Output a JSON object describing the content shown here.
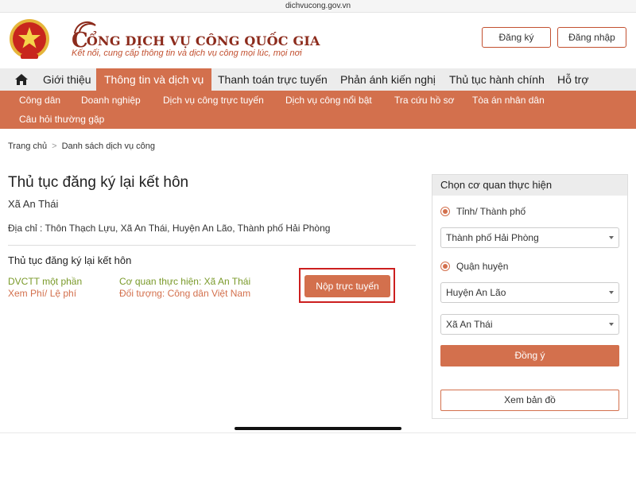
{
  "browser": {
    "url": "dichvucong.gov.vn"
  },
  "header": {
    "title": "ỔNG DỊCH VỤ CÔNG QUỐC GIA",
    "title_initial": "C",
    "subtitle": "Kết nối, cung cấp thông tin và dịch vụ công mọi lúc, mọi nơi",
    "register_label": "Đăng ký",
    "login_label": "Đăng nhập"
  },
  "main_nav": {
    "items": [
      {
        "label": "Giới thiệu",
        "active": false
      },
      {
        "label": "Thông tin và dịch vụ",
        "active": true
      },
      {
        "label": "Thanh toán trực tuyến",
        "active": false
      },
      {
        "label": "Phản ánh kiến nghị",
        "active": false
      },
      {
        "label": "Thủ tục hành chính",
        "active": false
      },
      {
        "label": "Hỗ trợ",
        "active": false
      }
    ]
  },
  "sub_nav": {
    "items": [
      "Công dân",
      "Doanh nghiệp",
      "Dịch vụ công trực tuyến",
      "Dịch vụ công nổi bật",
      "Tra cứu hồ sơ",
      "Tòa án nhân dân",
      "Câu hỏi thường gặp"
    ]
  },
  "breadcrumb": {
    "home": "Trang chủ",
    "separator": ">",
    "current": "Danh sách dịch vụ công"
  },
  "page": {
    "title": "Thủ tục đăng ký lại kết hôn",
    "agency": "Xã An Thái",
    "address": "Địa chỉ : Thôn Thạch Lựu, Xã An Thái, Huyện An Lão, Thành phố Hải Phòng"
  },
  "service": {
    "title": "Thủ tục đăng ký lại kết hôn",
    "level": "DVCTT một phần",
    "fee_link": "Xem Phí/ Lệ phí",
    "agency": "Cơ quan thực hiện: Xã An Thái",
    "audience": "Đối tượng: Công dân Việt Nam",
    "submit_label": "Nộp trực tuyến"
  },
  "panel": {
    "title": "Chọn cơ quan thực hiện",
    "province_radio": "Tỉnh/ Thành phố",
    "province_value": "Thành phố Hải Phòng",
    "district_radio": "Quận huyện",
    "district_value": "Huyện An Lão",
    "commune_value": "Xã An Thái",
    "agree_label": "Đồng ý",
    "map_label": "Xem bản đồ"
  },
  "colors": {
    "accent": "#d3704d",
    "brand_red": "#8c2b1c",
    "highlight_frame": "#cc1f1f",
    "green_text": "#7a9a2a"
  }
}
